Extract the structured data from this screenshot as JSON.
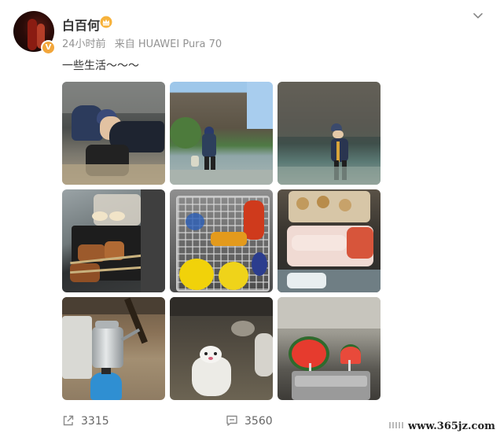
{
  "post": {
    "username": "白百何",
    "time": "24小时前",
    "source": "来自 HUAWEI Pura 70",
    "text": "一些生活～～～"
  },
  "icons": {
    "crown": "crown-icon",
    "verified": "verified-badge-icon",
    "menu": "chevron-down-icon",
    "share": "share-icon",
    "comment": "comment-icon"
  },
  "photos": [
    "photo-cliff-digging",
    "photo-beach-walk",
    "photo-cliff-person",
    "photo-grill-skewers",
    "photo-grill-basket",
    "photo-seafood-platter",
    "photo-kettle-stove",
    "photo-sand-figure",
    "photo-watermelon"
  ],
  "stats": {
    "shares": "3315",
    "comments": "3560"
  },
  "watermark": {
    "text": "www.365jz.com"
  },
  "colors": {
    "badge": "#f2a63b",
    "meta_text": "#939393",
    "body_text": "#333333"
  }
}
